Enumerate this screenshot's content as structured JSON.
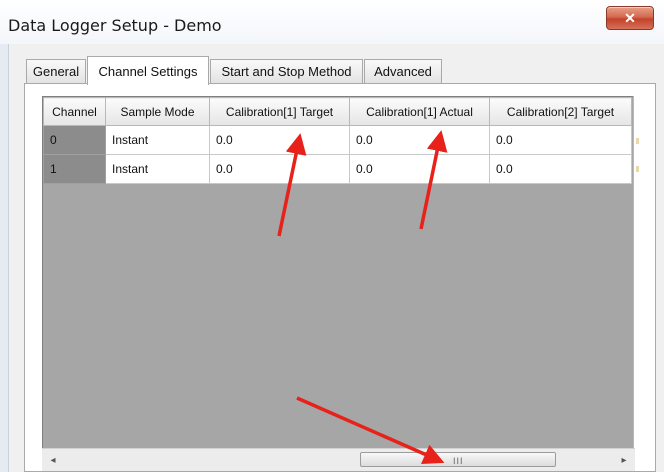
{
  "window": {
    "title": "Data Logger Setup - Demo",
    "close_glyph": "✕"
  },
  "tabs": [
    {
      "label": "General",
      "active": false
    },
    {
      "label": "Channel Settings",
      "active": true
    },
    {
      "label": "Start and Stop Method",
      "active": false
    },
    {
      "label": "Advanced",
      "active": false
    }
  ],
  "grid": {
    "columns": [
      "Channel",
      "Sample Mode",
      "Calibration[1] Target",
      "Calibration[1] Actual",
      "Calibration[2] Target"
    ],
    "rows": [
      {
        "channel": "0",
        "sample_mode": "Instant",
        "cal1_target": "0.0",
        "cal1_actual": "0.0",
        "cal2_target": "0.0"
      },
      {
        "channel": "1",
        "sample_mode": "Instant",
        "cal1_target": "0.0",
        "cal1_actual": "0.0",
        "cal2_target": "0.0"
      }
    ]
  },
  "scrollbar": {
    "left_arrow": "◂",
    "right_arrow": "▸",
    "grip": "III"
  },
  "annotation": {
    "arrow_color": "#e8211a",
    "arrow_count": 3
  },
  "colors": {
    "grid_background": "#a6a6a6",
    "close_button": "#c9432c"
  }
}
